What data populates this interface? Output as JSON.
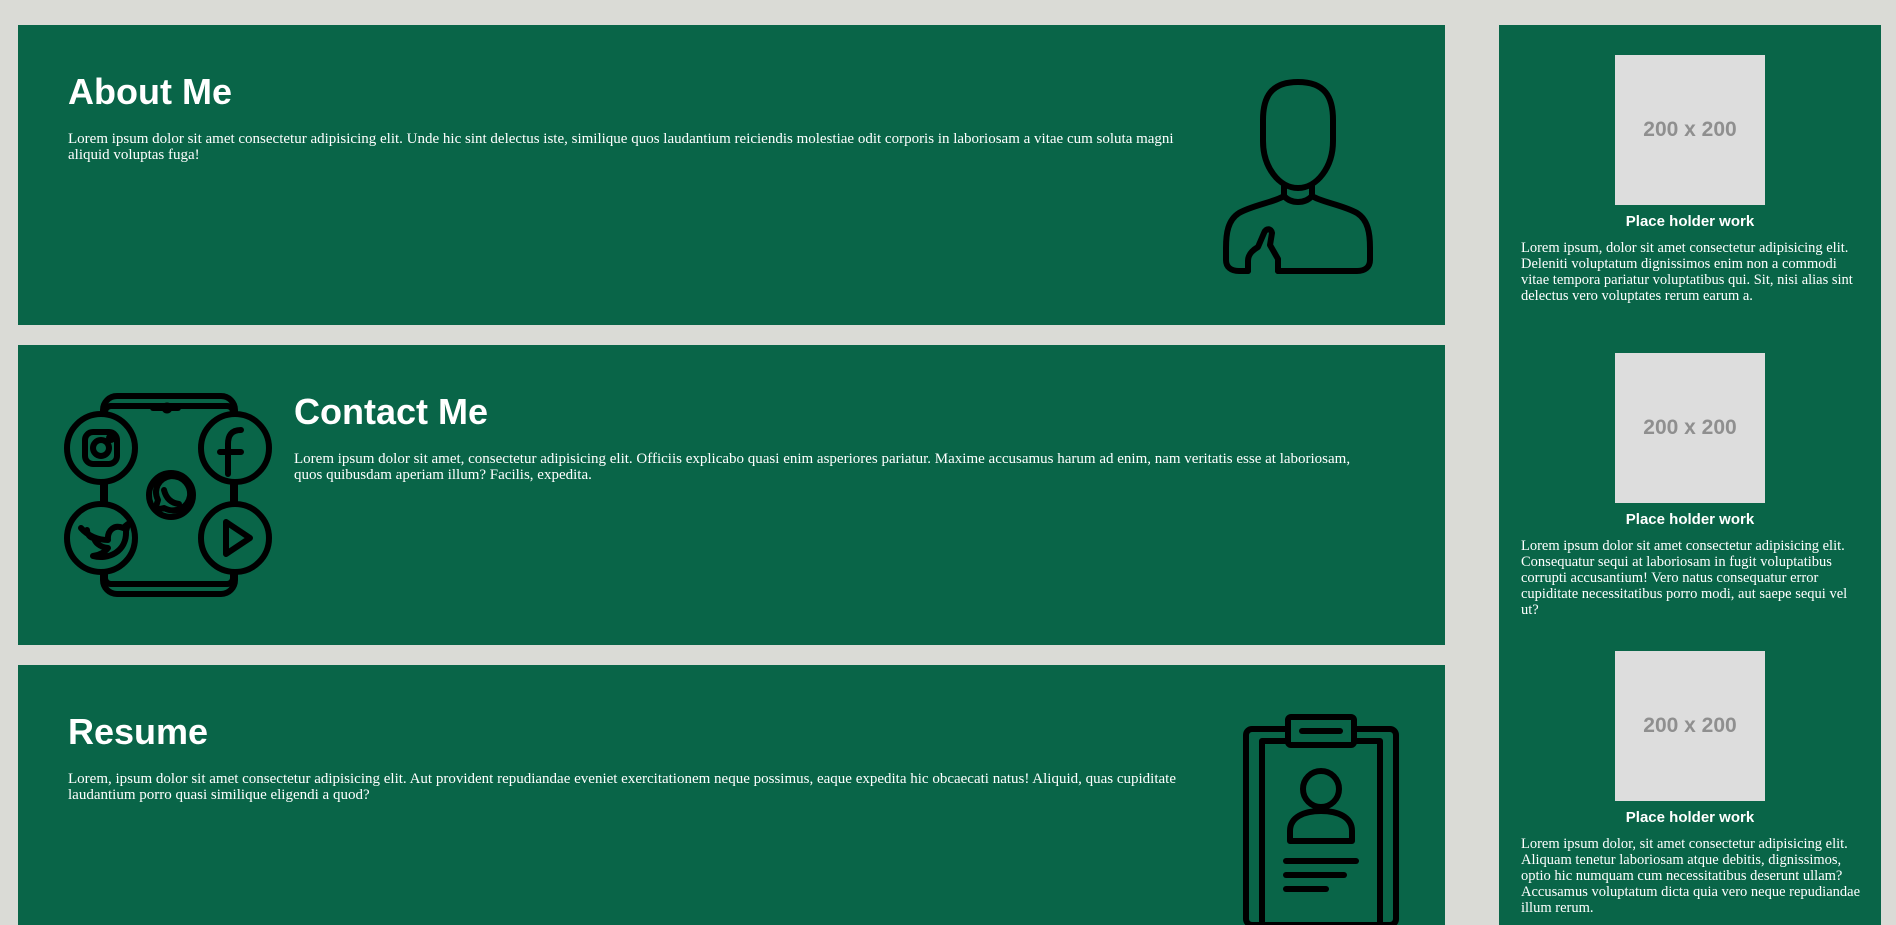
{
  "sections": {
    "about": {
      "title": "About Me",
      "text": "Lorem ipsum dolor sit amet consectetur adipisicing elit. Unde hic sint delectus iste, similique quos laudantium reiciendis molestiae odit corporis in laboriosam a vitae cum soluta magni aliquid voluptas fuga!",
      "icon": "person-icon"
    },
    "contact": {
      "title": "Contact Me",
      "text": "Lorem ipsum dolor sit amet, consectetur adipisicing elit. Officiis explicabo quasi enim asperiores pariatur. Maxime accusamus harum ad enim, nam veritatis esse at laboriosam, quos quibusdam aperiam illum? Facilis, expedita.",
      "icon": "social-phone-icon"
    },
    "resume": {
      "title": "Resume",
      "text": "Lorem, ipsum dolor sit amet consectetur adipisicing elit. Aut provident repudiandae eveniet exercitationem neque possimus, eaque expedita hic obcaecati natus! Aliquid, quas cupiditate laudantium porro quasi similique eligendi a quod?",
      "icon": "resume-clipboard-icon"
    }
  },
  "sidebar": {
    "works": [
      {
        "thumb": "200 x 200",
        "title": "Place holder work",
        "text": "Lorem ipsum, dolor sit amet consectetur adipisicing elit. Deleniti voluptatum dignissimos enim non a commodi vitae tempora pariatur voluptatibus qui. Sit, nisi alias sint delectus vero voluptates rerum earum a."
      },
      {
        "thumb": "200 x 200",
        "title": "Place holder work",
        "text": "Lorem ipsum dolor sit amet consectetur adipisicing elit. Consequatur sequi at laboriosam in fugit voluptatibus corrupti accusantium! Vero natus consequatur error cupiditate necessitatibus porro modi, aut saepe sequi vel ut?"
      },
      {
        "thumb": "200 x 200",
        "title": "Place holder work",
        "text": "Lorem ipsum dolor, sit amet consectetur adipisicing elit. Aliquam tenetur laboriosam atque debitis, dignissimos, optio hic numquam cum necessitatibus deserunt ullam? Accusamus voluptatum dicta quia vero neque repudiandae illum rerum."
      }
    ]
  },
  "colors": {
    "background": "#dadbd6",
    "panel": "#096548",
    "text": "#ffffff",
    "placeholder": "#dddddd",
    "placeholder_text": "#8f8f8f",
    "icon_stroke": "#000000"
  }
}
